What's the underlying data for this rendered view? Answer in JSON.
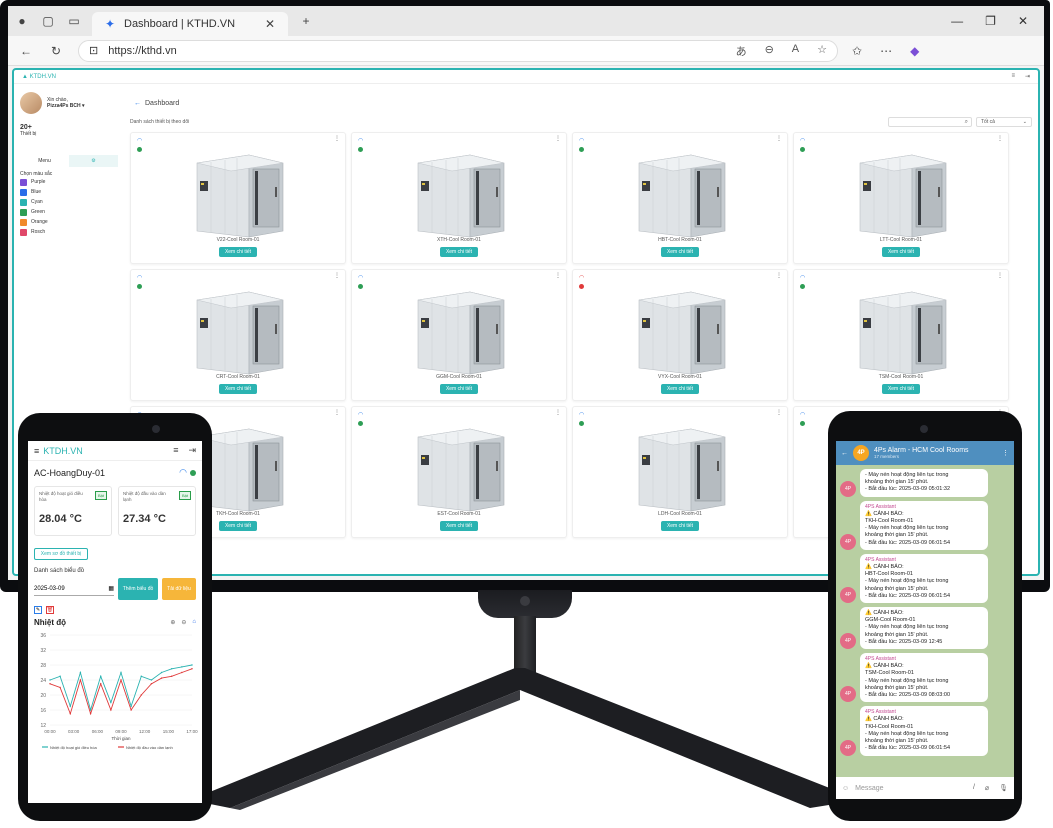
{
  "browser": {
    "tab_title": "Dashboard | KTHD.VN",
    "url": "https://kthd.vn",
    "url_icons": [
      "read-aloud-icon",
      "zoom-out-icon",
      "reader-icon",
      "favorite-icon"
    ]
  },
  "app": {
    "logo": "KTDH.VN",
    "sidebar": {
      "greeting": "Xin chào,",
      "user_name": "Pizza4Ps BCH ▾",
      "stat_value": "20+",
      "stat_label": "Thiết bị",
      "tab_menu": "Menu",
      "color_heading": "Chọn màu sắc",
      "colors": [
        {
          "label": "Purple",
          "hex": "#7b4fd6"
        },
        {
          "label": "Blue",
          "hex": "#2b6de9"
        },
        {
          "label": "Cyan",
          "hex": "#2bb3b1"
        },
        {
          "label": "Green",
          "hex": "#2e9e55"
        },
        {
          "label": "Orange",
          "hex": "#f08a2b"
        },
        {
          "label": "Rosch",
          "hex": "#e0486a"
        }
      ]
    },
    "breadcrumb": "Dashboard",
    "list_title": "Danh sách thiết bị theo dõi",
    "sort_label": "Tốt cả",
    "detail_label": "Xem chi tiết",
    "devices": [
      {
        "name": "V22-Cool Room-01",
        "status": "online"
      },
      {
        "name": "XTH-Cool Room-01",
        "status": "online"
      },
      {
        "name": "HBT-Cool Room-01",
        "status": "online"
      },
      {
        "name": "LTT-Cool Room-01",
        "status": "online"
      },
      {
        "name": "CRT-Cool Room-01",
        "status": "online"
      },
      {
        "name": "GGM-Cool Room-01",
        "status": "online"
      },
      {
        "name": "VYX-Cool Room-01",
        "status": "offline"
      },
      {
        "name": "TSM-Cool Room-01",
        "status": "online"
      },
      {
        "name": "TKH-Cool Room-01",
        "status": "online"
      },
      {
        "name": "EST-Cool Room-01",
        "status": "online"
      },
      {
        "name": "LDH-Cool Room-01",
        "status": "online"
      },
      {
        "name": "",
        "status": "online"
      }
    ]
  },
  "phone_left": {
    "logo": "KTDH.VN",
    "device_name": "AC-HoangDuy-01",
    "cards": [
      {
        "label": "Nhiệt độ hoạt gió điều hòa",
        "tag": "Bật",
        "value": "28.04 °C"
      },
      {
        "label": "Nhiệt độ đầu vào dàn lạnh",
        "tag": "Bật",
        "value": "27.34 °C"
      }
    ],
    "history_button": "Xem sơ đồ thiết bị",
    "list_title": "Danh sách biểu đồ",
    "date": "2025-03-09",
    "btn_primary": "Thêm biểu đồ",
    "btn_secondary": "Tải dữ liệu",
    "chart_title": "Nhiệt độ"
  },
  "chart_data": {
    "type": "line",
    "title": "Nhiệt độ",
    "xlabel": "Thời gian",
    "ylabel": "",
    "x": [
      "00:00",
      "03:00",
      "06:00",
      "09:00",
      "12:00",
      "15:00",
      "17:00"
    ],
    "yticks": [
      12,
      16,
      20,
      24,
      28,
      32,
      36
    ],
    "ylim": [
      12,
      36
    ],
    "series": [
      {
        "name": "Nhiệt độ hoạt gió điều hòa",
        "color": "#2bb3b1",
        "values": [
          24,
          25,
          17,
          26,
          16,
          25,
          18,
          26,
          17,
          25,
          24,
          26,
          27,
          27.5,
          28
        ]
      },
      {
        "name": "Nhiệt độ đầu vào dàn lạnh",
        "color": "#e03a3a",
        "values": [
          23,
          22,
          15,
          24,
          15,
          23,
          16,
          24,
          16,
          20,
          23,
          24.5,
          25,
          26,
          27
        ]
      }
    ]
  },
  "phone_right": {
    "chat_title": "4Ps Alarm - HCM Cool Rooms",
    "chat_subtitle": "17 members",
    "avatar": "4P",
    "input_placeholder": "Message",
    "messages": [
      {
        "sender": "",
        "lines": [
          "- Máy nén hoạt động liên tục trong",
          "khoảng thời gian 15' phút.",
          "- Bắt đầu lúc: 2025-03-09 05:01:32"
        ]
      },
      {
        "sender": "4PS Assistant",
        "lines": [
          "⚠️ CẢNH BÁO:",
          "TKH-Cool Room-01",
          "- Máy nén hoạt động liên tục trong",
          "khoảng thời gian 15' phút.",
          "- Bắt đầu lúc: 2025-03-09 06:01:54"
        ]
      },
      {
        "sender": "4PS Assistant",
        "lines": [
          "⚠️ CẢNH BÁO:",
          "HBT-Cool Room-01",
          "- Máy nén hoạt động liên tục trong",
          "khoảng thời gian 15' phút.",
          "- Bắt đầu lúc: 2025-03-09 06:01:54"
        ]
      },
      {
        "sender": "",
        "lines": [
          "⚠️ CẢNH BÁO:",
          "GGM-Cool Room-01",
          "- Máy nén hoạt động liên tục trong",
          "khoảng thời gian 15' phút.",
          "- Bắt đầu lúc: 2025-03-09 12:45"
        ]
      },
      {
        "sender": "4PS Assistant",
        "lines": [
          "⚠️ CẢNH BÁO:",
          "TSM-Cool Room-01",
          "- Máy nén hoạt động liên tục trong",
          "khoảng thời gian 15' phút.",
          "- Bắt đầu lúc: 2025-03-09 08:03:00"
        ]
      },
      {
        "sender": "4PS Assistant",
        "lines": [
          "⚠️ CẢNH BÁO:",
          "TKH-Cool Room-01",
          "- Máy nén hoạt động liên tục trong",
          "khoảng thời gian 15' phút.",
          "- Bắt đầu lúc: 2025-03-09 06:01:54"
        ]
      }
    ]
  }
}
